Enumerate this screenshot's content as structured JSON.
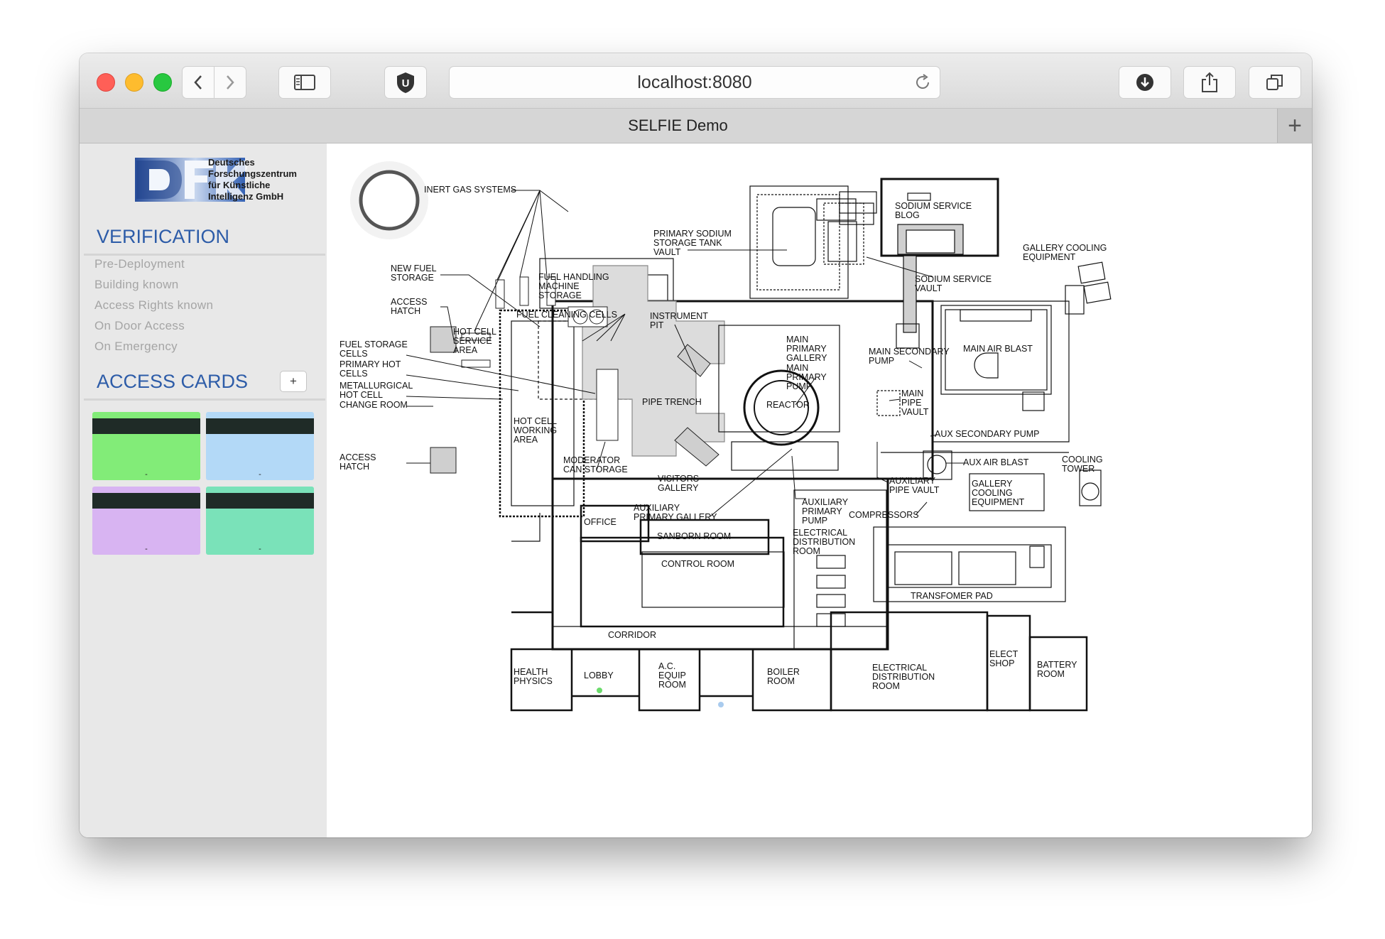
{
  "browser": {
    "url": "localhost:8080",
    "tab_title": "SELFIE Demo",
    "new_tab_label": "+"
  },
  "sidebar": {
    "logo_text_lines": [
      "Deutsches",
      "Forschungszentrum",
      "für Künstliche",
      "Intelligenz GmbH"
    ],
    "verification_title": "VERIFICATION",
    "verification_items": [
      "Pre-Deployment",
      "Building known",
      "Access Rights known",
      "On Door Access",
      "On Emergency"
    ],
    "access_cards_title": "ACCESS CARDS",
    "add_card_label": "+",
    "cards": [
      {
        "color": "#82ec78",
        "number": "-"
      },
      {
        "color": "#b3d9f7",
        "number": "-"
      },
      {
        "color": "#d8b4f2",
        "number": "-"
      },
      {
        "color": "#7ae2b9",
        "number": "-"
      }
    ]
  },
  "floorplan": {
    "labels": [
      "INERT GAS SYSTEMS",
      "PRIMARY SODIUM",
      "STORAGE TANK",
      "VAULT",
      "SODIUM SERVICE",
      "BLOG",
      "GALLERY COOLING",
      "EQUIPMENT",
      "NEW FUEL",
      "STORAGE",
      "FUEL HANDLING",
      "MACHINE",
      "STORAGE",
      "SODIUM SERVICE",
      "VAULT",
      "ACCESS",
      "HATCH",
      "FUEL CLEANING CELLS",
      "INSTRUMENT",
      "PIT",
      "HOT CELL",
      "SERVICE",
      "AREA",
      "FUEL STORAGE",
      "CELLS",
      "MAIN",
      "PRIMARY",
      "GALLERY",
      "MAIN SECONDARY",
      "PUMP",
      "MAIN AIR BLAST",
      "PRIMARY HOT",
      "CELLS",
      "MAIN",
      "PRIMARY",
      "PUMP",
      "METALLURGICAL",
      "HOT CELL",
      "PIPE TRENCH",
      "REACTOR",
      "MAIN",
      "PIPE",
      "VAULT",
      "CHANGE ROOM",
      "HOT CELL",
      "WORKING",
      "AREA",
      "AUX SECONDARY PUMP",
      "ACCESS",
      "HATCH",
      "MODERATOR",
      "CAN STORAGE",
      "AUX AIR BLAST",
      "COOLING",
      "TOWER",
      "VISITORS",
      "GALLERY",
      "AUXILIARY",
      "PIPE VAULT",
      "GALLERY",
      "COOLING",
      "EQUIPMENT",
      "AUXILIARY",
      "PRIMARY GALLERY",
      "AUXILIARY",
      "PRIMARY",
      "PUMP",
      "COMPRESSORS",
      "OFFICE",
      "SANBORN ROOM",
      "ELECTRICAL",
      "DISTRIBUTION",
      "ROOM",
      "CONTROL ROOM",
      "TRANSFOMER PAD",
      "CORRIDOR",
      "HEALTH",
      "PHYSICS",
      "LOBBY",
      "A.C.",
      "EQUIP",
      "ROOM",
      "BOILER",
      "ROOM",
      "ELECTRICAL",
      "DISTRIBUTION",
      "ROOM",
      "ELECT",
      "SHOP",
      "BATTERY",
      "ROOM"
    ]
  },
  "colors": {
    "accent": "#2d5ca8",
    "door_lobby": "#6cdb6c",
    "door_corridor": "#a9cbee"
  }
}
